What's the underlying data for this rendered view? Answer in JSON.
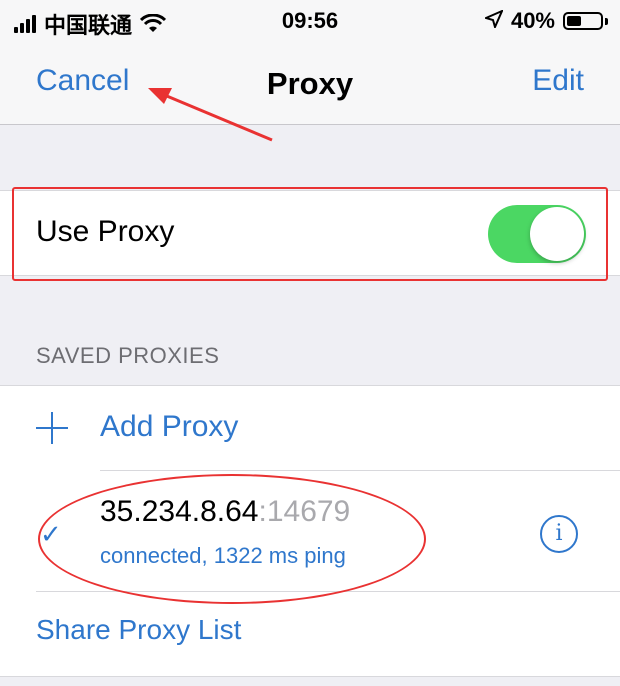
{
  "status_bar": {
    "carrier": "中国联通",
    "time": "09:56",
    "battery": "40%",
    "icons": [
      "signal-icon",
      "wifi-icon",
      "location-icon",
      "battery-icon"
    ]
  },
  "nav": {
    "cancel_label": "Cancel",
    "title": "Proxy",
    "edit_label": "Edit"
  },
  "use_proxy": {
    "label": "Use Proxy",
    "enabled": true
  },
  "saved_proxies": {
    "header": "SAVED PROXIES",
    "add_label": "Add Proxy",
    "items": [
      {
        "host": "35.234.8.64",
        "port": ":14679",
        "status": "connected, 1322 ms ping",
        "selected": true
      }
    ],
    "share_label": "Share Proxy List"
  },
  "colors": {
    "accent": "#2f77cc",
    "toggle_on": "#4bd763",
    "annotation": "#e93232",
    "background": "#efeff4"
  }
}
